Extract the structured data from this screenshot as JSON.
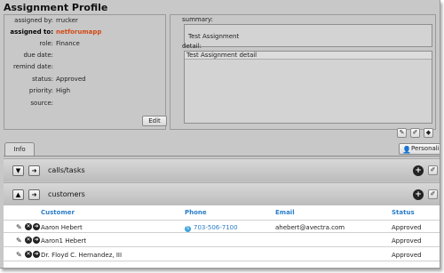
{
  "page": {
    "title": "Assignment Profile"
  },
  "profile": {
    "fields": [
      {
        "label": "assigned by:",
        "value": "rrucker",
        "bold": false,
        "link": false
      },
      {
        "label": "assigned to:",
        "value": "netforumapp",
        "bold": true,
        "link": true
      },
      {
        "label": "role:",
        "value": "Finance",
        "bold": false,
        "link": false
      },
      {
        "label": "due date:",
        "value": "",
        "bold": false,
        "link": false
      },
      {
        "label": "remind date:",
        "value": "",
        "bold": false,
        "link": false
      },
      {
        "label": "status:",
        "value": "Approved",
        "bold": false,
        "link": false
      },
      {
        "label": "priority:",
        "value": "High",
        "bold": false,
        "link": false
      },
      {
        "label": "source:",
        "value": "",
        "bold": false,
        "link": false
      }
    ],
    "edit_label": "Edit"
  },
  "summary": {
    "summary_label": "summary:",
    "summary_value": "Test Assignment",
    "detail_label": "detail:",
    "detail_value": "Test Assignment detail"
  },
  "tabs": [
    {
      "label": "Info",
      "active": true
    }
  ],
  "personalize_label": "Personalize",
  "sections": [
    {
      "title": "calls/tasks",
      "expanded": false
    },
    {
      "title": "customers",
      "expanded": true
    }
  ],
  "customers_table": {
    "columns": [
      "Customer",
      "Phone",
      "Email",
      "Status"
    ],
    "rows": [
      {
        "customer": "Aaron Hebert",
        "phone": "703-506-7100",
        "email": "ahebert@avectra.com",
        "status": "Approved"
      },
      {
        "customer": "Aaron1 Hebert",
        "phone": "",
        "email": "",
        "status": "Approved"
      },
      {
        "customer": "Dr. Floyd C. Hernandez, III",
        "phone": "",
        "email": "",
        "status": "Approved"
      }
    ]
  },
  "icons": {
    "edit": "pencil-icon",
    "close": "close-circle-icon",
    "arrow": "arrow-circle-icon",
    "add": "plus-circle-icon",
    "expand": "chevron-down-icon",
    "collapse": "chevron-up-icon",
    "go": "go-icon",
    "skype": "skype-icon",
    "person": "person-icon",
    "tag": "tag-icon"
  },
  "colors": {
    "link": "#d24a14",
    "accent": "#2a7dc8",
    "panel": "#c8c8c8"
  }
}
